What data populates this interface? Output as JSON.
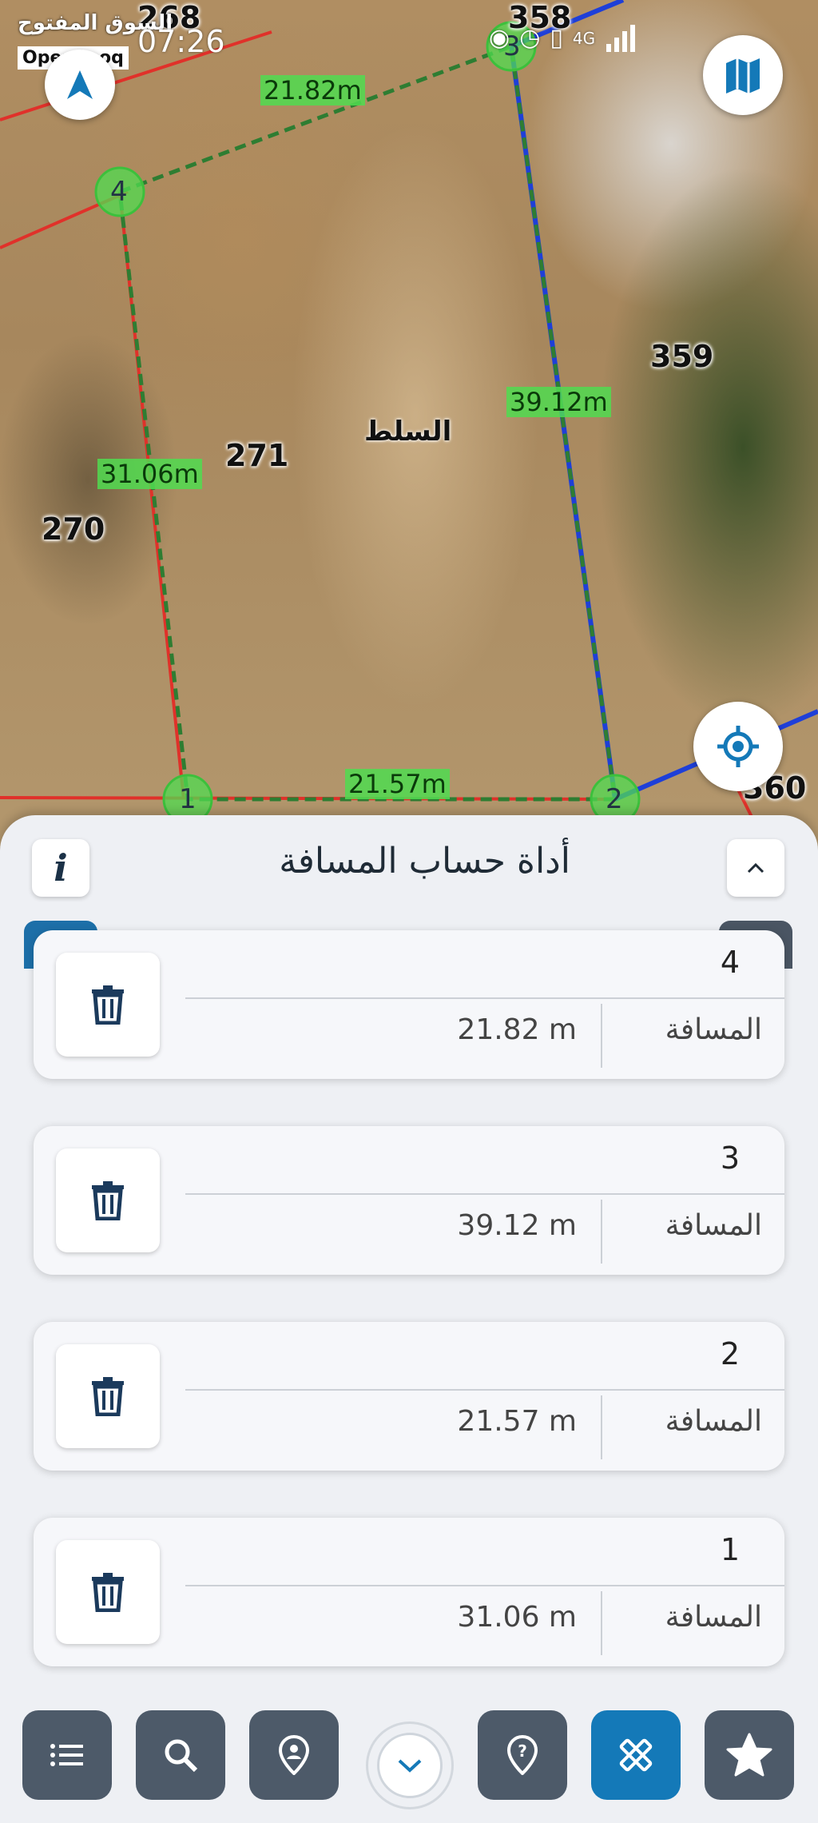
{
  "status_bar": {
    "time": "07:26",
    "brand_ar": "السوق المفتوح",
    "brand_en": "OpenSooq",
    "network": "4G"
  },
  "map": {
    "parcels": [
      "268",
      "271",
      "270",
      "359",
      "360",
      "358"
    ],
    "area_name": "السلط",
    "segment_labels": [
      "21.82m",
      "31.06m",
      "39.12m",
      "21.57m"
    ],
    "vertices": [
      "1",
      "2",
      "3",
      "4"
    ],
    "icons": {
      "north": "north-arrow-icon",
      "layers": "map-layers-icon",
      "locate": "locate-me-icon"
    }
  },
  "panel": {
    "title": "أداة حساب المسافة",
    "info_label": "i",
    "distance_label": "المسافة",
    "items": [
      {
        "number": "4",
        "value": "21.82 m"
      },
      {
        "number": "3",
        "value": "39.12 m"
      },
      {
        "number": "2",
        "value": "21.57 m"
      },
      {
        "number": "1",
        "value": "31.06 m"
      }
    ]
  },
  "colors": {
    "accent_blue": "#1479b8",
    "nav_gray": "#4d5a69",
    "measure_green": "#2e7d32",
    "boundary_red": "#e0312a",
    "road_blue": "#1e3fd8"
  }
}
